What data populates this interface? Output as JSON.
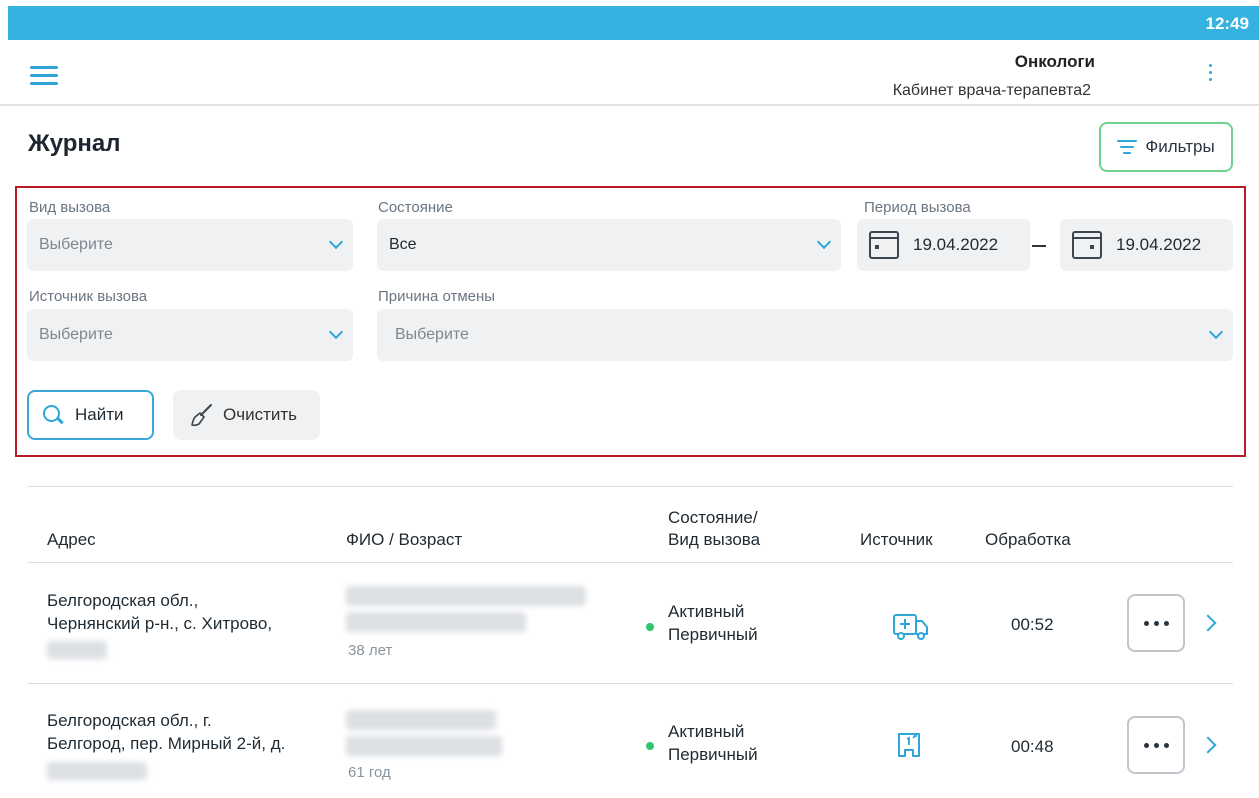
{
  "status_bar": {
    "time": "12:49"
  },
  "header": {
    "org": "Онкологи",
    "cabinet": "Кабинет врача-терапевта2"
  },
  "page": {
    "title": "Журнал",
    "filters_label": "Фильтры"
  },
  "filters": {
    "call_type": {
      "label": "Вид вызова",
      "value": "Выберите"
    },
    "state": {
      "label": "Состояние",
      "value": "Все"
    },
    "period": {
      "label": "Период вызова",
      "from": "19.04.2022",
      "to": "19.04.2022"
    },
    "source": {
      "label": "Источник вызова",
      "value": "Выберите"
    },
    "cancel_reason": {
      "label": "Причина отмены",
      "value": "Выберите"
    },
    "find_label": "Найти",
    "clear_label": "Очистить"
  },
  "table": {
    "headers": {
      "address": "Адрес",
      "fio": "ФИО / Возраст",
      "state_line1": "Состояние/",
      "state_line2": "Вид вызова",
      "source": "Источник",
      "processing": "Обработка"
    },
    "rows": [
      {
        "address_line1": "Белгородская обл.,",
        "address_line2": "Чернянский р-н., с. Хитрово,",
        "age": "38 лет",
        "state": "Активный",
        "call_type": "Первичный",
        "source_icon": "ambulance-icon",
        "processing": "00:52"
      },
      {
        "address_line1": "Белгородская обл., г.",
        "address_line2": "Белгород, пер. Мирный 2-й, д.",
        "age": "61 год",
        "state": "Активный",
        "call_type": "Первичный",
        "source_icon": "phone-call-icon",
        "processing": "00:48"
      }
    ]
  },
  "colors": {
    "accent": "#2ea6d8",
    "status_bar": "#35b2df",
    "active_dot": "#2fc46f",
    "filters_border": "#6ed38d",
    "panel_highlight": "#b81c28"
  }
}
